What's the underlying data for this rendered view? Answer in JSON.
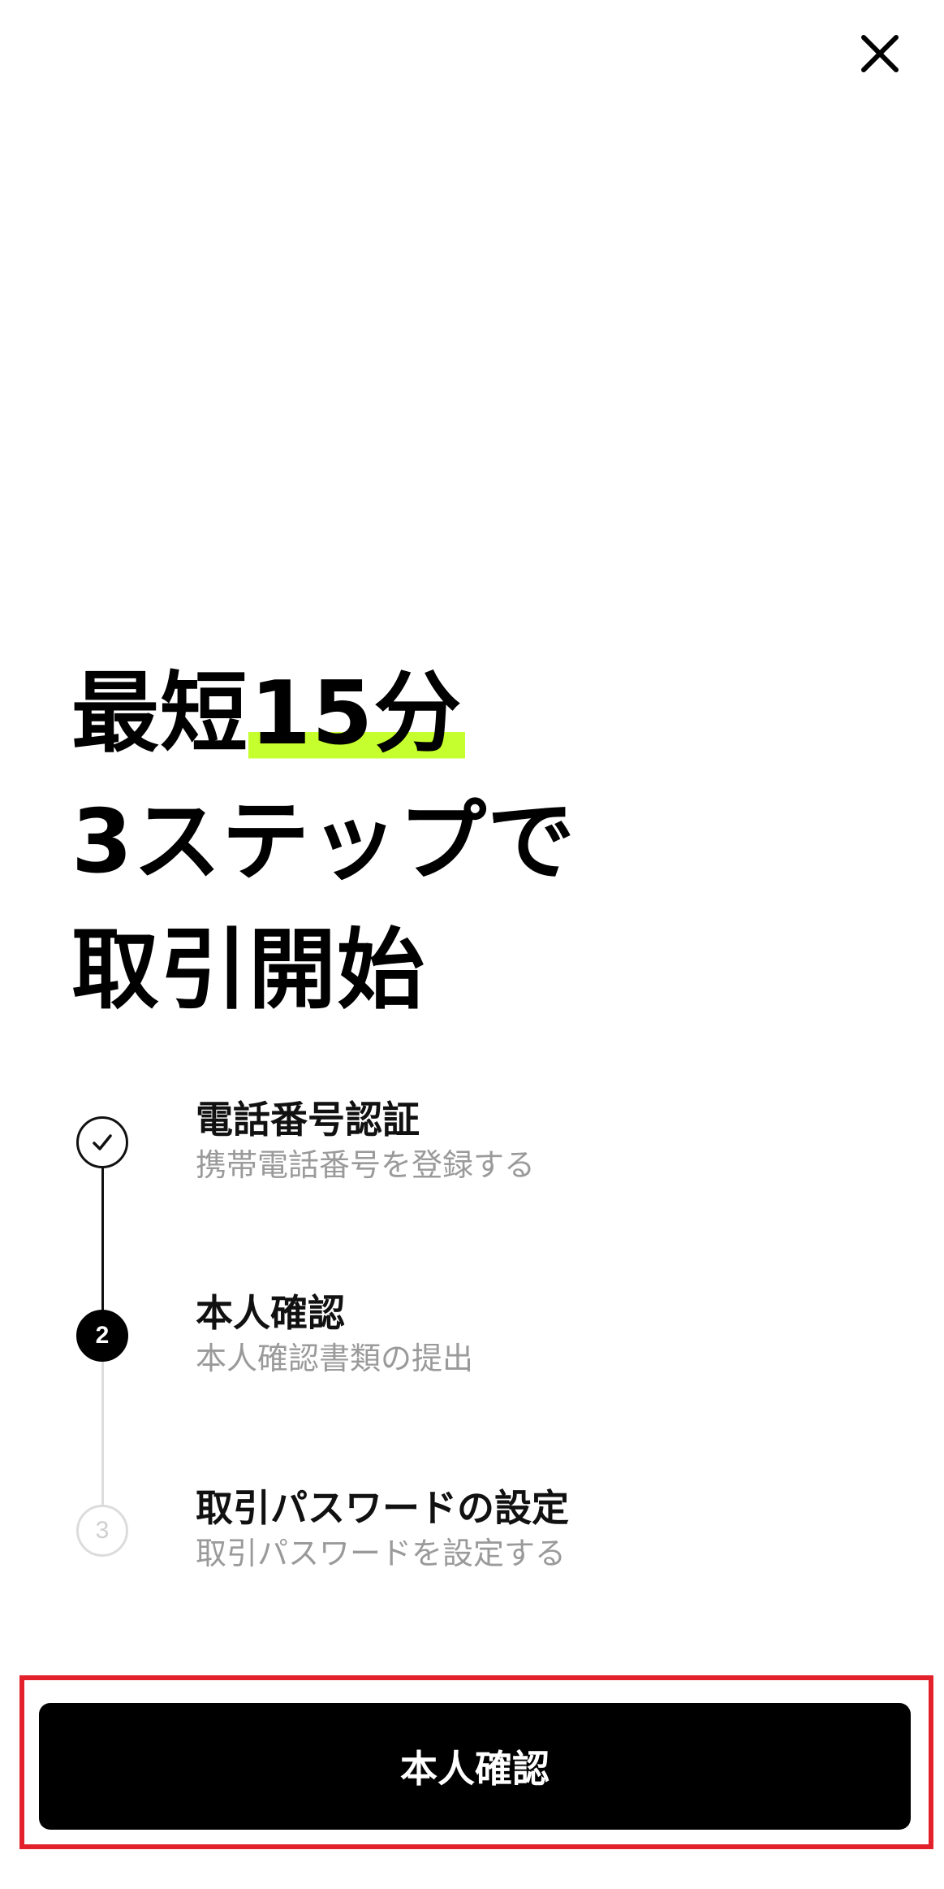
{
  "header": {
    "close_icon": "close-icon"
  },
  "headline": {
    "line1_prefix": "最短",
    "line1_highlight": "15分",
    "line2": "3ステップで",
    "line3": "取引開始",
    "highlight_color": "#c6ff2e"
  },
  "steps": [
    {
      "marker": "",
      "status": "completed",
      "title": "電話番号認証",
      "description": "携帯電話番号を登録する"
    },
    {
      "marker": "2",
      "status": "current",
      "title": "本人確認",
      "description": "本人確認書類の提出"
    },
    {
      "marker": "3",
      "status": "pending",
      "title": "取引パスワードの設定",
      "description": "取引パスワードを設定する"
    }
  ],
  "cta": {
    "label": "本人確認",
    "highlight_border_color": "#e3212b"
  }
}
